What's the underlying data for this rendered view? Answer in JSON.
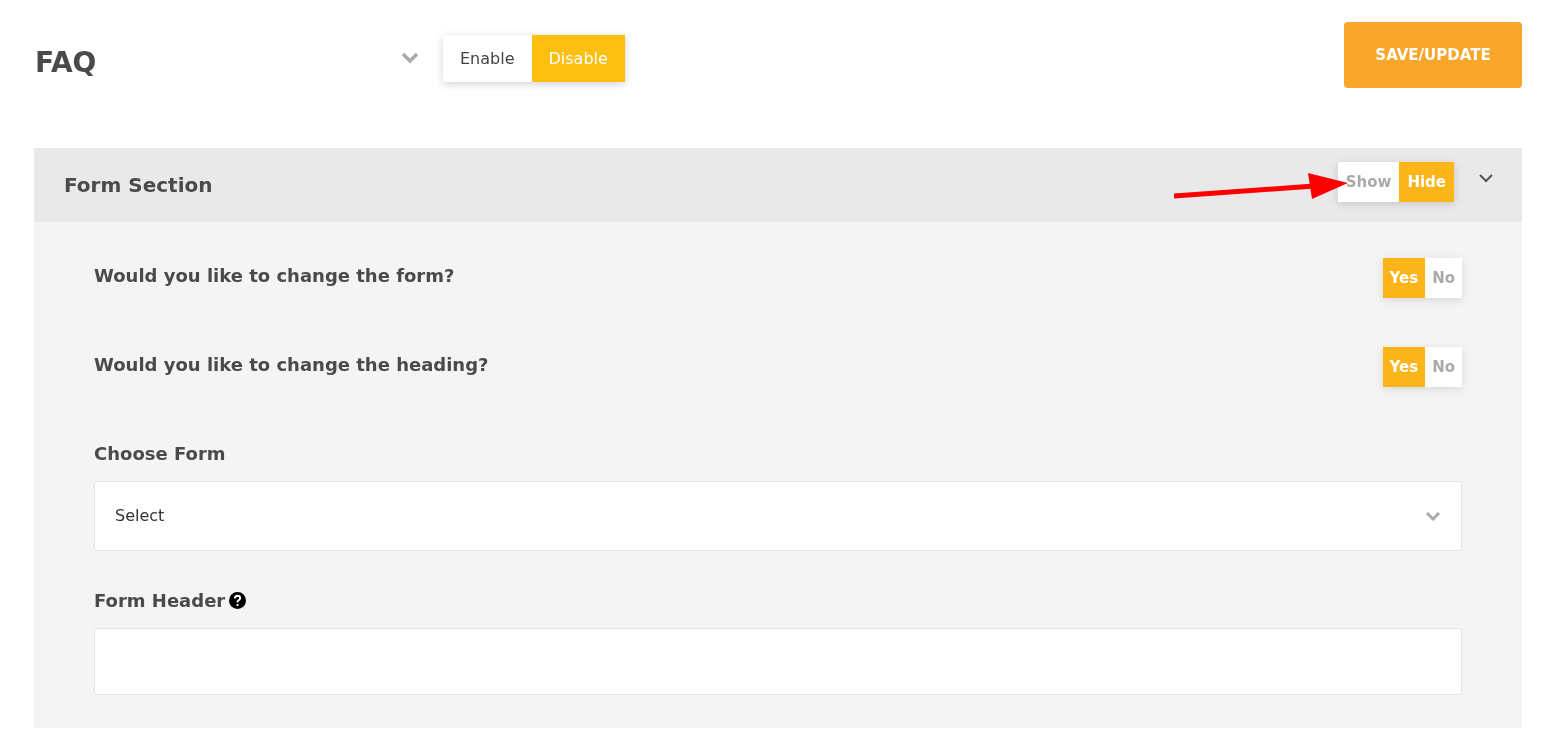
{
  "header": {
    "title": "FAQ",
    "status_toggle": [
      {
        "label": "Enable",
        "selected": false
      },
      {
        "label": "Disable",
        "selected": true
      }
    ],
    "save_button": "SAVE/UPDATE"
  },
  "section": {
    "title": "Form Section",
    "visibility_toggle": [
      {
        "label": "Show",
        "selected": false
      },
      {
        "label": "Hide",
        "selected": true
      }
    ],
    "questions": [
      {
        "label": "Would you like to change the form?",
        "options": [
          {
            "label": "Yes",
            "selected": true
          },
          {
            "label": "No",
            "selected": false
          }
        ]
      },
      {
        "label": "Would you like to change the heading?",
        "options": [
          {
            "label": "Yes",
            "selected": true
          },
          {
            "label": "No",
            "selected": false
          }
        ]
      }
    ],
    "fields": [
      {
        "kind": "select",
        "label": "Choose Form",
        "value": "Select"
      },
      {
        "kind": "text",
        "label": "Form Header",
        "help": true
      }
    ]
  }
}
